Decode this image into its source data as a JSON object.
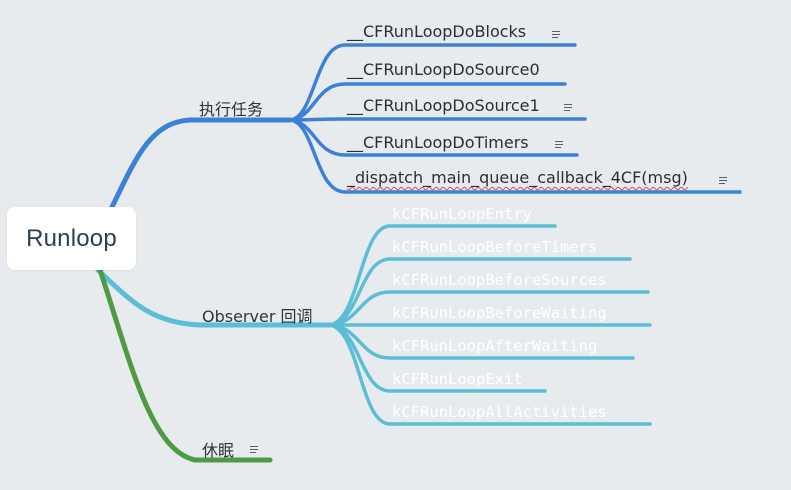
{
  "root": {
    "label": "Runloop"
  },
  "branches": {
    "tasks": {
      "label": "执行任务",
      "color": "#3b82d6",
      "items": [
        {
          "label": "__CFRunLoopDoBlocks",
          "note_icon": "note-icon"
        },
        {
          "label": "__CFRunLoopDoSource0"
        },
        {
          "label": "__CFRunLoopDoSource1",
          "note_icon": "note-icon"
        },
        {
          "label": "__CFRunLoopDoTimers",
          "note_icon": "note-icon"
        },
        {
          "label": "_dispatch_main_queue_callback_4CF(msg)",
          "note_icon": "note-icon"
        }
      ]
    },
    "observer": {
      "label": "Observer 回调",
      "color": "#5bbdd6",
      "items": [
        {
          "label": "kCFRunLoopEntry"
        },
        {
          "label": "kCFRunLoopBeforeTimers"
        },
        {
          "label": "kCFRunLoopBeforeSources"
        },
        {
          "label": "kCFRunLoopBeforeWaiting"
        },
        {
          "label": "kCFRunLoopAfterWaiting"
        },
        {
          "label": "kCFRunLoopExit"
        },
        {
          "label": "kCFRunLoopAllActivities"
        }
      ]
    },
    "sleep": {
      "label": "休眠",
      "color": "#4e9a45",
      "note_icon": "note-icon"
    }
  }
}
